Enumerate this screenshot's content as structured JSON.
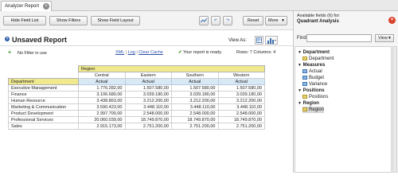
{
  "tab": {
    "label": "Analyzer Report"
  },
  "toolbar": {
    "hide_field_list": "Hide Field List",
    "show_filters": "Show Filters",
    "show_field_layout": "Show Field Layout",
    "reset": "Reset",
    "more": "More"
  },
  "report": {
    "title": "Unsaved Report",
    "view_as": "View As:",
    "no_filter": "No Filter in use",
    "links": [
      "XML",
      "Log",
      "Clear Cache"
    ],
    "link_sep": "|",
    "status": "Your report is ready.",
    "rows_label": "Rows: 7",
    "columns_label": "Columns: 4"
  },
  "grid": {
    "column_dimension": "Region",
    "row_dimension": "Department",
    "columns": [
      "Central",
      "Eastern",
      "Southern",
      "Western"
    ],
    "measure": "Actual",
    "rows": [
      {
        "name": "Executive Management",
        "values": [
          "1.776.282,00",
          "1.507.580,00",
          "1.507.580,00",
          "1.507.580,00"
        ]
      },
      {
        "name": "Finance",
        "values": [
          "3.106.680,00",
          "3.039.180,00",
          "3.039.180,00",
          "3.039.180,00"
        ]
      },
      {
        "name": "Human Resource",
        "values": [
          "3.438.863,00",
          "3.212.200,00",
          "3.212.200,00",
          "3.212.200,00"
        ]
      },
      {
        "name": "Marketing & Communication",
        "values": [
          "3.590.423,00",
          "3.448.110,00",
          "3.448.110,00",
          "3.448.110,00"
        ]
      },
      {
        "name": "Product Development",
        "values": [
          "2.997.700,00",
          "2.548.000,00",
          "2.548.000,00",
          "2.548.000,00"
        ]
      },
      {
        "name": "Professional Services",
        "values": [
          "20.060.039,00",
          "18.749.870,00",
          "18.749.870,00",
          "18.749.870,00"
        ]
      },
      {
        "name": "Sales",
        "values": [
          "2.915.173,00",
          "2.751.200,00",
          "2.751.200,00",
          "2.751.200,00"
        ]
      }
    ]
  },
  "panel": {
    "available": "Available fields (6) for:",
    "title": "Quadrant Analysis",
    "find_label": "Find:",
    "find_value": "",
    "view_button": "View",
    "tree": [
      {
        "label": "Department",
        "kind": "cat"
      },
      {
        "label": "Department",
        "kind": "dim"
      },
      {
        "label": "Measures",
        "kind": "cat"
      },
      {
        "label": "Actual",
        "kind": "meas"
      },
      {
        "label": "Budget",
        "kind": "meas"
      },
      {
        "label": "Variance",
        "kind": "meas"
      },
      {
        "label": "Positions",
        "kind": "cat"
      },
      {
        "label": "Positions",
        "kind": "dim"
      },
      {
        "label": "Region",
        "kind": "cat"
      },
      {
        "label": "Region",
        "kind": "dim"
      }
    ]
  },
  "colors": {
    "accent": "#2b5ea8",
    "header_yellow": "#f0e98e",
    "measure_blue": "#d8e8f5",
    "status_green": "#3f9a2e",
    "close_red": "#d9412c"
  }
}
